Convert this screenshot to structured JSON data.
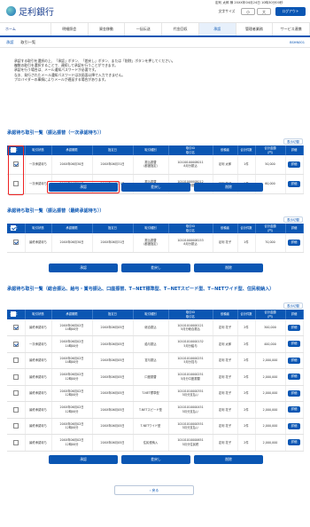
{
  "header": {
    "logo": "足利銀行",
    "user_line": "定利 太郎 様 20XX年04月24日 10時30分00秒",
    "user_line2": "前回ログイン日時",
    "font_label": "文字サイズ",
    "font_small": "小",
    "font_large": "大",
    "logout": "ログアウト"
  },
  "nav": [
    "ホーム",
    "明細照会",
    "資金移動",
    "一括伝送",
    "代金回収",
    "承認",
    "管理者業務",
    "サービス連携"
  ],
  "breadcrumb": {
    "main": "承認",
    "sub": "取引一覧",
    "id": "BSHN001"
  },
  "intro": [
    "承認する取引を選択の上、「承認」ボタン、「差戻し」ボタン、または「削除」ボタンを押してください。",
    "複数の取引を選択することで、連続して承認を行うことができます。",
    "承認を行う場合は、メール通知パスワードが必要です。",
    "なお、発行されたメール通知パスワードは次画面以降で入力できません。",
    "プロバイダーの事情によりメールが遅延する場合があります。"
  ],
  "sections": [
    {
      "title": "承認待ち取引一覧（振込振替（一次承認待ち））",
      "count": "全2件",
      "tool": "表示切替",
      "headers": [
        "全て",
        "取引状態",
        "承認期限",
        "指定日",
        "取引種別",
        "取引ID\n取引名",
        "依頼者",
        "合計件数",
        "合計金額\n(円)",
        "詳細"
      ],
      "rows": [
        [
          "一次承認待ち",
          "20XX年06月30日",
          "20XX年06月31日",
          "振込振替\n（都度指定）",
          "10100100008011\n8月分振込",
          "足利 太郎",
          "1件",
          "50,000",
          "詳細"
        ],
        [
          "一次承認待ち",
          "20XX年06月30日",
          "20XX年06月31日",
          "振込振替\n（都度指定）",
          "10101000008012\n8月分振込",
          "足利 花子",
          "1件",
          "60,000",
          "詳細"
        ]
      ],
      "buttons": [
        "承認",
        "差戻し",
        "削除"
      ]
    },
    {
      "title": "承認待ち取引一覧（振込振替（最終承認待ち））",
      "count": "全1件",
      "tool": "表示切替",
      "headers": [
        "全て",
        "取引状態",
        "承認期限",
        "指定日",
        "取引種別",
        "取引ID\n取引名",
        "依頼者",
        "合計件数",
        "合計金額\n(円)",
        "詳細"
      ],
      "rows": [
        [
          "最終承認待ち",
          "20XX年06月30日",
          "20XX年06月31日",
          "振込振替\n（都度指定）",
          "10101000008153\n8月分振込",
          "足利 花子",
          "1件",
          "70,000",
          "詳細"
        ]
      ],
      "buttons": [
        "承認",
        "差戻し",
        "削除"
      ]
    },
    {
      "title": "承認待ち取引一覧（総合振込、給与・賞与振込、口座振替、T−NET標準型、T−NETスピード型、T−NETワイド型、住民税納入）",
      "count": "全9件",
      "tool": "表示切替",
      "headers": [
        "全て",
        "取引状態",
        "承認期限",
        "指定日",
        "取引種別",
        "取引ID\n取引名",
        "依頼者",
        "合計件数",
        "合計金額\n(円)",
        "詳細"
      ],
      "rows": [
        [
          "最終承認待ち",
          "20XX年06月02日\n14時00分",
          "20XX年06月05日",
          "総合振込",
          "10101010000121\n5月分総合振込",
          "定利 花子",
          "2件",
          "300,000",
          "詳細"
        ],
        [
          "一次承認待ち",
          "20XX年06月02日\n14時00分",
          "20XX年06月05日",
          "給与振込",
          "10101010000132\n5月分給与",
          "定利 太郎",
          "2件",
          "400,000",
          "詳細"
        ],
        [
          "最終承認待ち",
          "20XX年06月02日\n14時00分",
          "20XX年06月05日",
          "賞与振込",
          "10101010000251\n5月分賞与",
          "定利 花子",
          "2件",
          "2,000,000",
          "詳細"
        ],
        [
          "最終承認待ち",
          "20XX年06月02日\n12時00分",
          "20XX年06月05日",
          "口座振替",
          "10101010000251\n5月分口座振替",
          "定利 花子",
          "2件",
          "2,000,000",
          "詳細"
        ],
        [
          "最終承認待ち",
          "20XX年06月02日\n12時00分",
          "20XX年06月05日",
          "T-NET標準型",
          "10101010000351\n5月分支払い",
          "定利 花子",
          "2件",
          "2,000,000",
          "詳細"
        ],
        [
          "最終承認待ち",
          "20XX年06月02日\n12時00分",
          "20XX年06月05日",
          "T-NETスピード型",
          "10101010000451\n5月分支払い",
          "定利 花子",
          "2件",
          "2,000,000",
          "詳細"
        ],
        [
          "最終承認待ち",
          "20XX年06月02日\n12時00分",
          "20XX年06月05日",
          "T-NETワイド型",
          "10101010000551\n5月分支払い",
          "定利 花子",
          "2件",
          "2,000,000",
          "詳細"
        ],
        [
          "最終承認待ち",
          "20XX年06月02日\n12時00分",
          "20XX年06月05日",
          "住民税納入",
          "10101010000651\n5月分住民税",
          "定利 花子",
          "2件",
          "2,000,000",
          "詳細"
        ]
      ],
      "buttons": [
        "承認",
        "差戻し",
        "削除"
      ]
    }
  ],
  "footer": {
    "back": "戻る"
  }
}
